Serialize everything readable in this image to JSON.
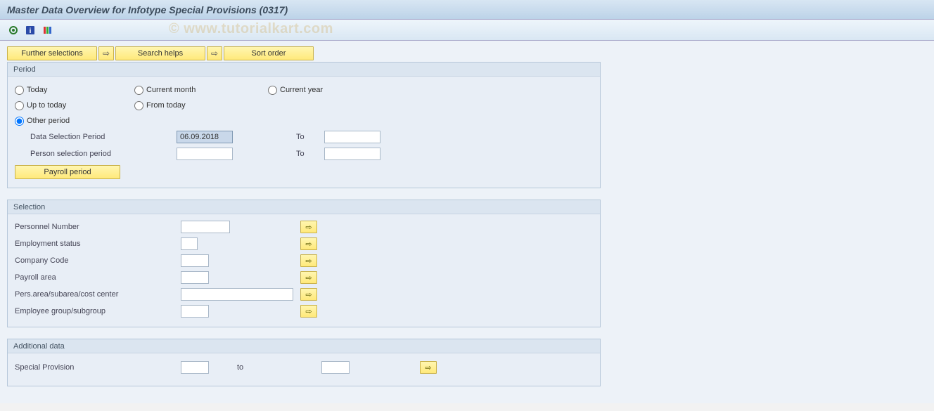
{
  "title": "Master Data Overview for Infotype Special Provisions (0317)",
  "watermark": "© www.tutorialkart.com",
  "toolbar_icons": {
    "execute": "execute-icon",
    "info": "info-icon",
    "options": "options-icon"
  },
  "buttons": {
    "further_selections": "Further selections",
    "search_helps": "Search helps",
    "sort_order": "Sort order",
    "payroll_period": "Payroll period"
  },
  "period": {
    "title": "Period",
    "options": {
      "today": "Today",
      "current_month": "Current month",
      "current_year": "Current year",
      "up_to_today": "Up to today",
      "from_today": "From today",
      "other_period": "Other period"
    },
    "selected": "other_period",
    "data_selection_label": "Data Selection Period",
    "data_selection_from": "06.09.2018",
    "data_selection_to": "",
    "person_selection_label": "Person selection period",
    "person_selection_from": "",
    "person_selection_to": "",
    "to_label": "To"
  },
  "selection": {
    "title": "Selection",
    "rows": [
      {
        "label": "Personnel Number",
        "value": "",
        "width": "w70"
      },
      {
        "label": "Employment status",
        "value": "",
        "width": "w24"
      },
      {
        "label": "Company Code",
        "value": "",
        "width": "w40"
      },
      {
        "label": "Payroll area",
        "value": "",
        "width": "w40"
      },
      {
        "label": "Pers.area/subarea/cost center",
        "value": "",
        "width": "w160"
      },
      {
        "label": "Employee group/subgroup",
        "value": "",
        "width": "w40"
      }
    ]
  },
  "additional": {
    "title": "Additional data",
    "label": "Special Provision",
    "from": "",
    "to_label": "to",
    "to": ""
  }
}
